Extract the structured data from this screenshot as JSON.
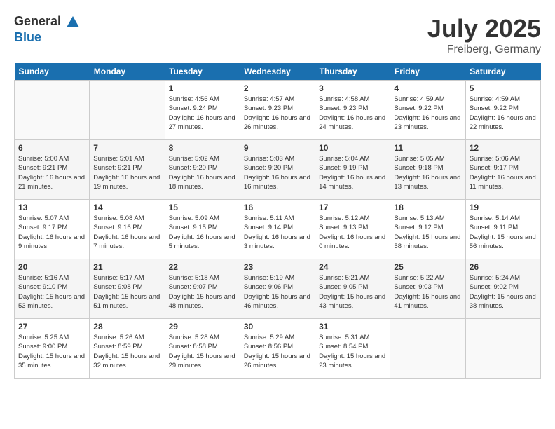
{
  "header": {
    "logo_general": "General",
    "logo_blue": "Blue",
    "month_year": "July 2025",
    "location": "Freiberg, Germany"
  },
  "days_of_week": [
    "Sunday",
    "Monday",
    "Tuesday",
    "Wednesday",
    "Thursday",
    "Friday",
    "Saturday"
  ],
  "weeks": [
    [
      {
        "day": "",
        "sunrise": "",
        "sunset": "",
        "daylight": ""
      },
      {
        "day": "",
        "sunrise": "",
        "sunset": "",
        "daylight": ""
      },
      {
        "day": "1",
        "sunrise": "Sunrise: 4:56 AM",
        "sunset": "Sunset: 9:24 PM",
        "daylight": "Daylight: 16 hours and 27 minutes."
      },
      {
        "day": "2",
        "sunrise": "Sunrise: 4:57 AM",
        "sunset": "Sunset: 9:23 PM",
        "daylight": "Daylight: 16 hours and 26 minutes."
      },
      {
        "day": "3",
        "sunrise": "Sunrise: 4:58 AM",
        "sunset": "Sunset: 9:23 PM",
        "daylight": "Daylight: 16 hours and 24 minutes."
      },
      {
        "day": "4",
        "sunrise": "Sunrise: 4:59 AM",
        "sunset": "Sunset: 9:22 PM",
        "daylight": "Daylight: 16 hours and 23 minutes."
      },
      {
        "day": "5",
        "sunrise": "Sunrise: 4:59 AM",
        "sunset": "Sunset: 9:22 PM",
        "daylight": "Daylight: 16 hours and 22 minutes."
      }
    ],
    [
      {
        "day": "6",
        "sunrise": "Sunrise: 5:00 AM",
        "sunset": "Sunset: 9:21 PM",
        "daylight": "Daylight: 16 hours and 21 minutes."
      },
      {
        "day": "7",
        "sunrise": "Sunrise: 5:01 AM",
        "sunset": "Sunset: 9:21 PM",
        "daylight": "Daylight: 16 hours and 19 minutes."
      },
      {
        "day": "8",
        "sunrise": "Sunrise: 5:02 AM",
        "sunset": "Sunset: 9:20 PM",
        "daylight": "Daylight: 16 hours and 18 minutes."
      },
      {
        "day": "9",
        "sunrise": "Sunrise: 5:03 AM",
        "sunset": "Sunset: 9:20 PM",
        "daylight": "Daylight: 16 hours and 16 minutes."
      },
      {
        "day": "10",
        "sunrise": "Sunrise: 5:04 AM",
        "sunset": "Sunset: 9:19 PM",
        "daylight": "Daylight: 16 hours and 14 minutes."
      },
      {
        "day": "11",
        "sunrise": "Sunrise: 5:05 AM",
        "sunset": "Sunset: 9:18 PM",
        "daylight": "Daylight: 16 hours and 13 minutes."
      },
      {
        "day": "12",
        "sunrise": "Sunrise: 5:06 AM",
        "sunset": "Sunset: 9:17 PM",
        "daylight": "Daylight: 16 hours and 11 minutes."
      }
    ],
    [
      {
        "day": "13",
        "sunrise": "Sunrise: 5:07 AM",
        "sunset": "Sunset: 9:17 PM",
        "daylight": "Daylight: 16 hours and 9 minutes."
      },
      {
        "day": "14",
        "sunrise": "Sunrise: 5:08 AM",
        "sunset": "Sunset: 9:16 PM",
        "daylight": "Daylight: 16 hours and 7 minutes."
      },
      {
        "day": "15",
        "sunrise": "Sunrise: 5:09 AM",
        "sunset": "Sunset: 9:15 PM",
        "daylight": "Daylight: 16 hours and 5 minutes."
      },
      {
        "day": "16",
        "sunrise": "Sunrise: 5:11 AM",
        "sunset": "Sunset: 9:14 PM",
        "daylight": "Daylight: 16 hours and 3 minutes."
      },
      {
        "day": "17",
        "sunrise": "Sunrise: 5:12 AM",
        "sunset": "Sunset: 9:13 PM",
        "daylight": "Daylight: 16 hours and 0 minutes."
      },
      {
        "day": "18",
        "sunrise": "Sunrise: 5:13 AM",
        "sunset": "Sunset: 9:12 PM",
        "daylight": "Daylight: 15 hours and 58 minutes."
      },
      {
        "day": "19",
        "sunrise": "Sunrise: 5:14 AM",
        "sunset": "Sunset: 9:11 PM",
        "daylight": "Daylight: 15 hours and 56 minutes."
      }
    ],
    [
      {
        "day": "20",
        "sunrise": "Sunrise: 5:16 AM",
        "sunset": "Sunset: 9:10 PM",
        "daylight": "Daylight: 15 hours and 53 minutes."
      },
      {
        "day": "21",
        "sunrise": "Sunrise: 5:17 AM",
        "sunset": "Sunset: 9:08 PM",
        "daylight": "Daylight: 15 hours and 51 minutes."
      },
      {
        "day": "22",
        "sunrise": "Sunrise: 5:18 AM",
        "sunset": "Sunset: 9:07 PM",
        "daylight": "Daylight: 15 hours and 48 minutes."
      },
      {
        "day": "23",
        "sunrise": "Sunrise: 5:19 AM",
        "sunset": "Sunset: 9:06 PM",
        "daylight": "Daylight: 15 hours and 46 minutes."
      },
      {
        "day": "24",
        "sunrise": "Sunrise: 5:21 AM",
        "sunset": "Sunset: 9:05 PM",
        "daylight": "Daylight: 15 hours and 43 minutes."
      },
      {
        "day": "25",
        "sunrise": "Sunrise: 5:22 AM",
        "sunset": "Sunset: 9:03 PM",
        "daylight": "Daylight: 15 hours and 41 minutes."
      },
      {
        "day": "26",
        "sunrise": "Sunrise: 5:24 AM",
        "sunset": "Sunset: 9:02 PM",
        "daylight": "Daylight: 15 hours and 38 minutes."
      }
    ],
    [
      {
        "day": "27",
        "sunrise": "Sunrise: 5:25 AM",
        "sunset": "Sunset: 9:00 PM",
        "daylight": "Daylight: 15 hours and 35 minutes."
      },
      {
        "day": "28",
        "sunrise": "Sunrise: 5:26 AM",
        "sunset": "Sunset: 8:59 PM",
        "daylight": "Daylight: 15 hours and 32 minutes."
      },
      {
        "day": "29",
        "sunrise": "Sunrise: 5:28 AM",
        "sunset": "Sunset: 8:58 PM",
        "daylight": "Daylight: 15 hours and 29 minutes."
      },
      {
        "day": "30",
        "sunrise": "Sunrise: 5:29 AM",
        "sunset": "Sunset: 8:56 PM",
        "daylight": "Daylight: 15 hours and 26 minutes."
      },
      {
        "day": "31",
        "sunrise": "Sunrise: 5:31 AM",
        "sunset": "Sunset: 8:54 PM",
        "daylight": "Daylight: 15 hours and 23 minutes."
      },
      {
        "day": "",
        "sunrise": "",
        "sunset": "",
        "daylight": ""
      },
      {
        "day": "",
        "sunrise": "",
        "sunset": "",
        "daylight": ""
      }
    ]
  ]
}
